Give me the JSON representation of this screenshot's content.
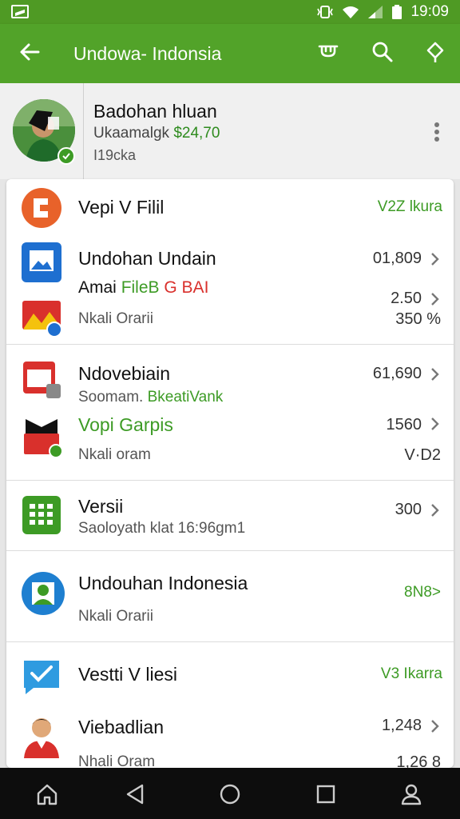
{
  "status_bar": {
    "time": "19:09"
  },
  "app_bar": {
    "title": "Undowa‑ Indonsia"
  },
  "profile": {
    "name": "Badohan hluan",
    "line2_prefix": "Ukaamalgk",
    "line2_amount": "$24,70",
    "line3": "I19cka"
  },
  "items": [
    {
      "title": "Vepi V Filil",
      "value": "V2Z lkura"
    },
    {
      "title": "Undohan Undain",
      "value": "01,809"
    },
    {
      "title_plain": "Amai ",
      "title_green": "FileB",
      "title_red": " G BAI",
      "value": "2.50"
    },
    {
      "subtitle": "Nkali Orarii",
      "value": "350 %"
    },
    {
      "title": "Ndovebiain",
      "value": "61,690"
    },
    {
      "subtitle_plain": "Soomam. ",
      "subtitle_green": "BkeatiVank"
    },
    {
      "title": "Vopi Garpis",
      "value": "1560"
    },
    {
      "subtitle": "Nkali oram",
      "value": "V·D2"
    },
    {
      "title": "Versii",
      "value": "300"
    },
    {
      "subtitle": "Saoloyath klat 16:96gm1"
    },
    {
      "title": "Undouhan Indonesia",
      "value": "8N8>"
    },
    {
      "subtitle": "Nkali Orarii"
    },
    {
      "title": "Vestti V liesi",
      "value": "V3 Ikarra"
    },
    {
      "title": "Viebadlian",
      "value": "1,248"
    },
    {
      "subtitle": "Nhali Oram",
      "value": "1,26 8"
    }
  ],
  "colors": {
    "brand_green": "#52a329",
    "accent_green": "#3d9b25",
    "orange": "#e8622a",
    "blue": "#1e6fd0",
    "red": "#d9302c"
  }
}
